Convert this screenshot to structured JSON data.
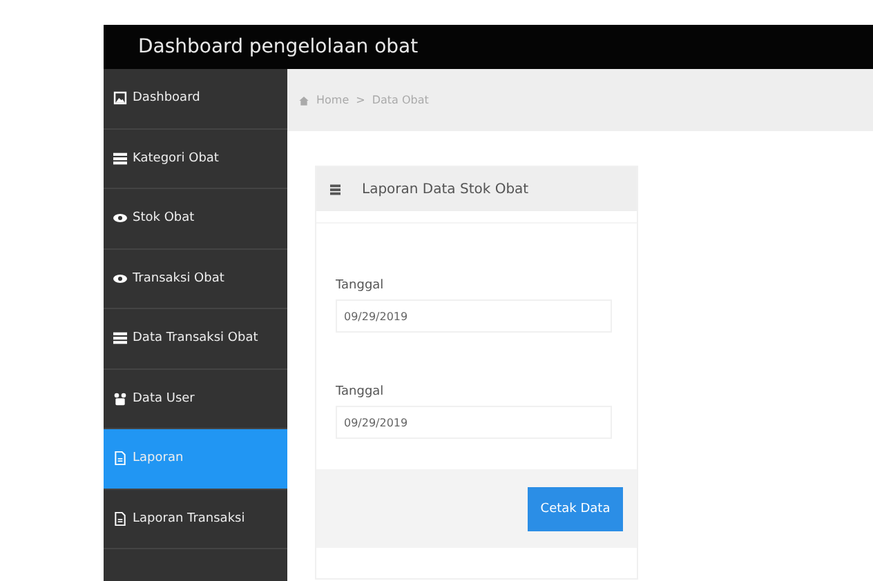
{
  "header": {
    "title": "Dashboard pengelolaan obat"
  },
  "sidebar": {
    "items": [
      {
        "label": "Dashboard",
        "kind": "picture",
        "selected": false
      },
      {
        "label": "Kategori Obat",
        "kind": "list",
        "selected": false
      },
      {
        "label": "Stok Obat",
        "kind": "eye",
        "selected": false
      },
      {
        "label": "Transaksi Obat",
        "kind": "eye",
        "selected": false
      },
      {
        "label": "Data Transaksi Obat",
        "kind": "list",
        "selected": false
      },
      {
        "label": "Data User",
        "kind": "users",
        "selected": false
      },
      {
        "label": "Laporan",
        "kind": "file",
        "selected": true
      },
      {
        "label": "Laporan Transaksi",
        "kind": "file",
        "selected": false
      }
    ]
  },
  "breadcrumb": {
    "items": [
      "Home",
      "Data Obat"
    ],
    "separator": ">"
  },
  "card": {
    "title": "Laporan Data Stok Obat",
    "fields": [
      {
        "label": "Tanggal",
        "value": "09/29/2019"
      },
      {
        "label": "Tanggal",
        "value": "09/29/2019"
      }
    ],
    "button": "Cetak Data"
  }
}
